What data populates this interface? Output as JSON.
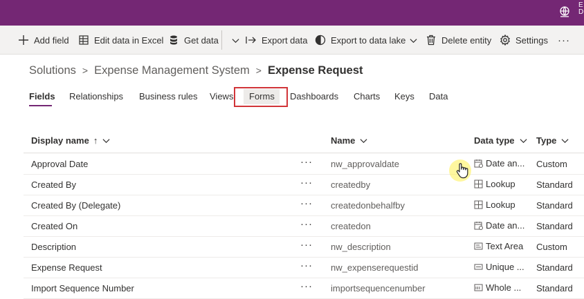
{
  "topbar": {
    "corner_line1": "E",
    "corner_line2": "D",
    "env_icon": "globe-icon"
  },
  "commands": {
    "add_field": "Add field",
    "edit_excel": "Edit data in Excel",
    "get_data": "Get data",
    "export_data": "Export data",
    "export_lake": "Export to data lake",
    "delete_entity": "Delete entity",
    "settings": "Settings",
    "more": "···"
  },
  "breadcrumb": {
    "root": "Solutions",
    "solution": "Expense Management System",
    "current": "Expense Request"
  },
  "tabs": [
    "Fields",
    "Relationships",
    "Business rules",
    "Views",
    "Forms",
    "Dashboards",
    "Charts",
    "Keys",
    "Data"
  ],
  "table": {
    "headers": {
      "display_name": "Display name",
      "sort_indicator": "↑",
      "name": "Name",
      "data_type": "Data type",
      "type": "Type"
    },
    "more_label": "···",
    "rows": [
      {
        "display": "Approval Date",
        "name": "nw_approvaldate",
        "dtype": "Date an...",
        "dtype_icon": "calendar-icon",
        "type": "Custom"
      },
      {
        "display": "Created By",
        "name": "createdby",
        "dtype": "Lookup",
        "dtype_icon": "lookup-icon",
        "type": "Standard"
      },
      {
        "display": "Created By (Delegate)",
        "name": "createdonbehalfby",
        "dtype": "Lookup",
        "dtype_icon": "lookup-icon",
        "type": "Standard"
      },
      {
        "display": "Created On",
        "name": "createdon",
        "dtype": "Date an...",
        "dtype_icon": "calendar-icon",
        "type": "Standard"
      },
      {
        "display": "Description",
        "name": "nw_description",
        "dtype": "Text Area",
        "dtype_icon": "text-area-icon",
        "type": "Custom"
      },
      {
        "display": "Expense Request",
        "name": "nw_expenserequestid",
        "dtype": "Unique ...",
        "dtype_icon": "unique-id-icon",
        "type": "Standard"
      },
      {
        "display": "Import Sequence Number",
        "name": "importsequencenumber",
        "dtype": "Whole ...",
        "dtype_icon": "whole-number-icon",
        "type": "Standard"
      }
    ]
  },
  "colors": {
    "brand": "#742774",
    "highlight_border": "#d13438",
    "cursor_glow": "#fff050"
  }
}
